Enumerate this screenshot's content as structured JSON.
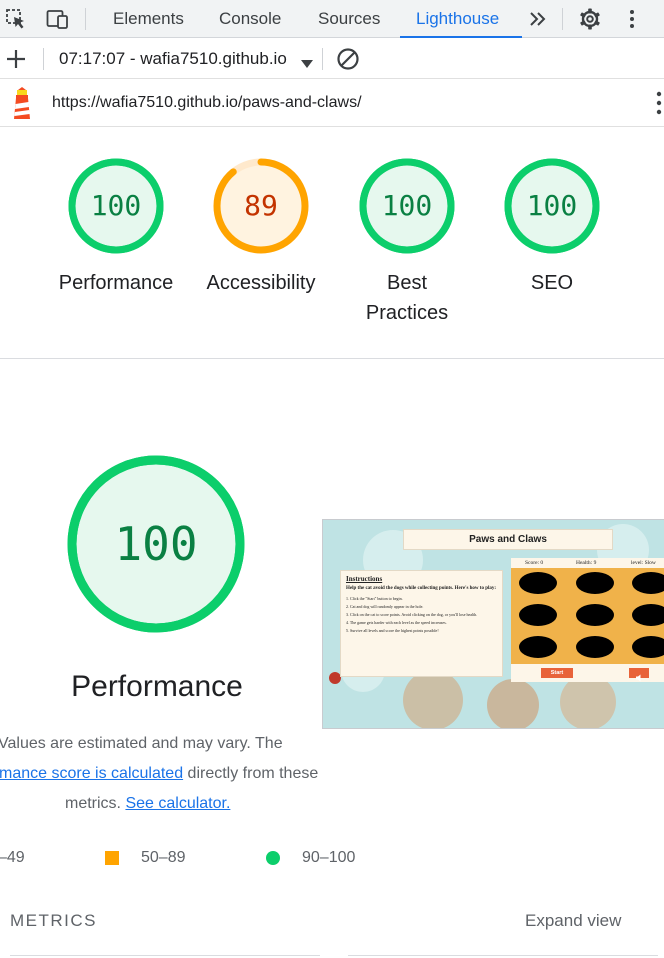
{
  "devtools": {
    "tabs": [
      "Elements",
      "Console",
      "Sources",
      "Lighthouse"
    ],
    "active_tab": "Lighthouse",
    "icons": [
      "inspect-element-icon",
      "device-toolbar-icon",
      "more-tabs-icon",
      "settings-gear-icon",
      "kebab-menu-icon"
    ]
  },
  "report_bar": {
    "title": "07:17:07 - wafia7510.github.io",
    "icons": [
      "plus-icon",
      "dropdown-caret-icon",
      "clear-block-icon"
    ]
  },
  "url_bar": {
    "url": "https://wafia7510.github.io/paws-and-claws/",
    "icons": [
      "lighthouse-logo-icon",
      "kebab-menu-icon"
    ]
  },
  "scores": [
    {
      "label": "Performance",
      "value": 100,
      "score": 1.0,
      "status": "pass"
    },
    {
      "label": "Accessibility",
      "value": 89,
      "score": 0.89,
      "status": "average"
    },
    {
      "label": "Best Practices",
      "label_lines": [
        "Best",
        "Practices"
      ],
      "value": 100,
      "score": 1.0,
      "status": "pass"
    },
    {
      "label": "SEO",
      "value": 100,
      "score": 1.0,
      "status": "pass"
    }
  ],
  "performance": {
    "value": 100,
    "title": "Performance",
    "desc_line1": "Values are estimated and may vary. The",
    "desc_link1": "mance score is calculated",
    "desc_line2_rest": " directly from these",
    "desc_line3_pre": "metrics. ",
    "desc_link2": "See calculator."
  },
  "screenshot": {
    "title": "Paws and Claws",
    "instructions_heading": "Instructions",
    "intro": "Help the cat avoid the dogs while collecting points. Here's how to play:",
    "steps": [
      "1. Click the \"Start\" button to begin.",
      "2. Cat and dog will randomly appear in the hole.",
      "3. Click on the cat to score points. Avoid clicking on the dog, or you'll lose health.",
      "4. The game gets harder with each level as the speed increases.",
      "5. Survive all levels and score the highest points possible!"
    ],
    "stats": {
      "score": "Score: 0",
      "health": "Health: 9",
      "level": "level: Slow"
    },
    "start_label": "Start",
    "sound_icon": "speaker-icon"
  },
  "legend": {
    "fail_range": "–49",
    "average_range": "50–89",
    "pass_range": "90–100"
  },
  "metrics": {
    "heading": "METRICS",
    "expand_label": "Expand view"
  },
  "colors": {
    "accent": "#1a73e8",
    "pass": "#0cce6b",
    "pass_text": "#0a8043",
    "pass_fill": "#e6f8ee",
    "average": "#ffa400",
    "average_text": "#c33300",
    "average_fill": "#fff3e0",
    "lighthouse_orange": "#f44b21"
  }
}
